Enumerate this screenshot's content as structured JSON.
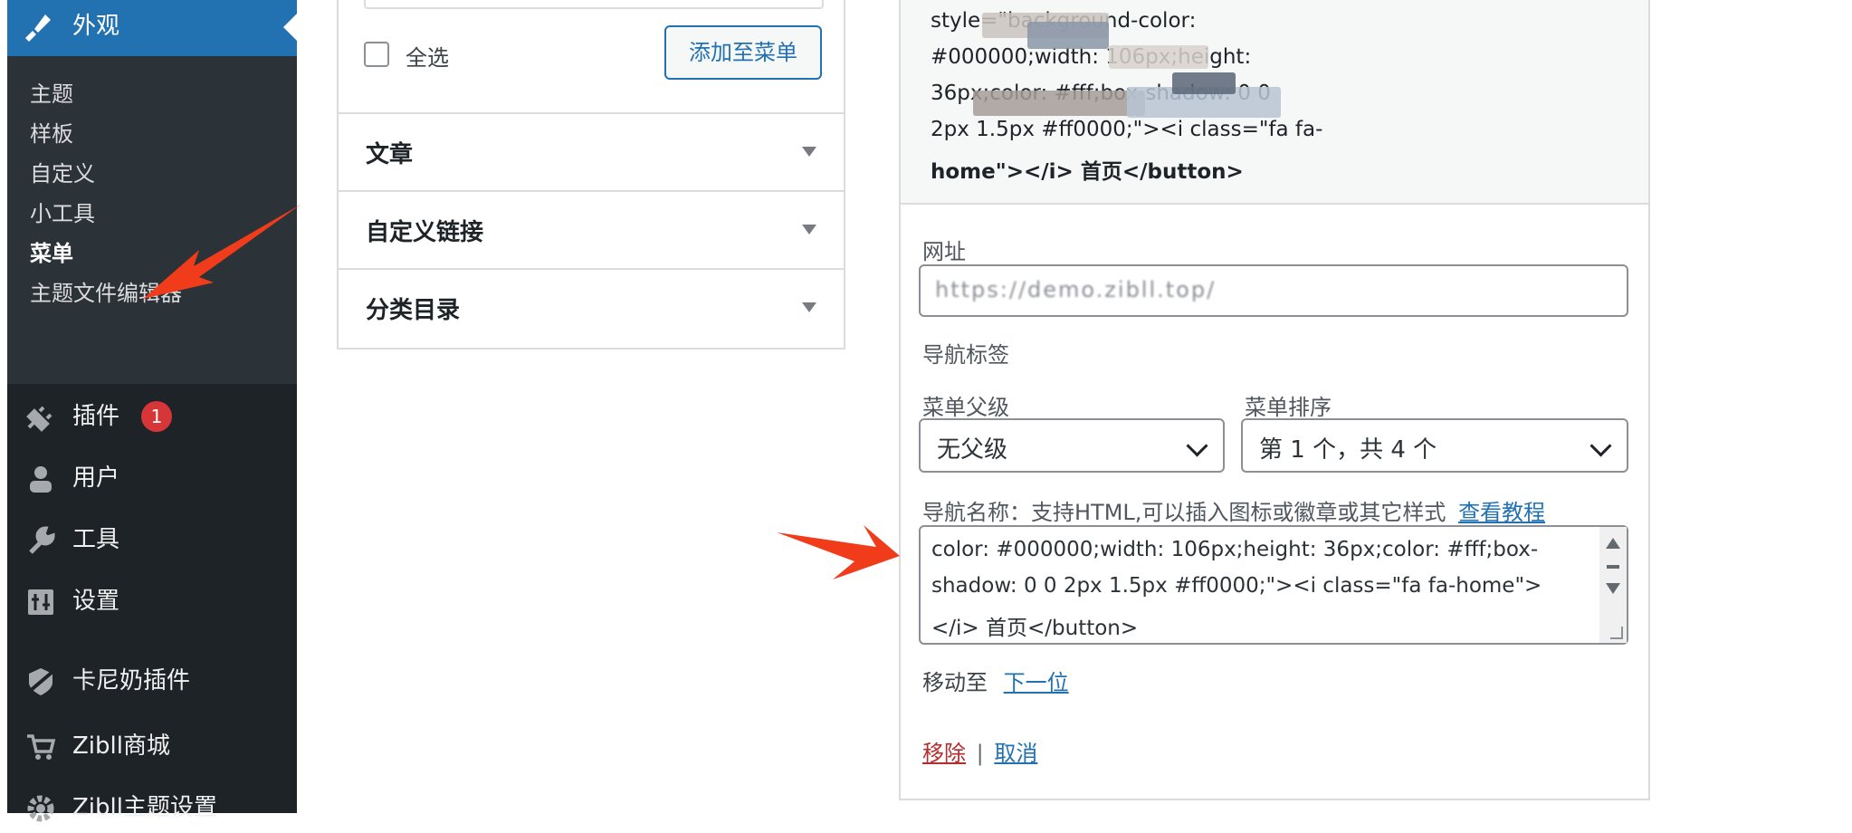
{
  "sidebar": {
    "active_label": "外观",
    "submenu": [
      "主题",
      "样板",
      "自定义",
      "小工具",
      "菜单",
      "主题文件编辑器"
    ],
    "current_submenu_index": 4,
    "items": [
      {
        "label": "插件",
        "icon": "plugin-icon",
        "badge": "1"
      },
      {
        "label": "用户",
        "icon": "user-icon"
      },
      {
        "label": "工具",
        "icon": "wrench-icon"
      },
      {
        "label": "设置",
        "icon": "settings-icon"
      },
      {
        "label": "卡尼奶插件",
        "icon": "shield-slash-icon"
      },
      {
        "label": "Zibll商城",
        "icon": "cart-icon"
      },
      {
        "label": "Zibll主题设置",
        "icon": "gear-icon"
      }
    ]
  },
  "middle": {
    "select_all_label": "全选",
    "add_button": "添加至菜单",
    "accordions": [
      "文章",
      "自定义链接",
      "分类目录"
    ]
  },
  "right": {
    "preview_lines": [
      "style=\"background-color:",
      "#000000;width: 106px;height:",
      "36px;color: #fff;box-shadow: 0 0",
      "2px 1.5px #ff0000;\"><i class=\"fa fa-",
      "home\"></i> 首页</button>"
    ],
    "url_label": "网址",
    "url_value": "https://demo.zibll.top/",
    "nav_tag_label": "导航标签",
    "parent_label": "菜单父级",
    "parent_value": "无父级",
    "order_label": "菜单排序",
    "order_value": "第 1 个，共 4 个",
    "nav_name_label": "导航名称：支持HTML,可以插入图标或徽章或其它样式",
    "nav_name_link": "查看教程",
    "nav_name_lines": [
      "color: #000000;width: 106px;height: 36px;color: #fff;box-",
      "shadow: 0 0 2px 1.5px #ff0000;\"><i class=\"fa fa-home\">",
      "</i> 首页</button>"
    ],
    "move_label": "移动至",
    "move_link": "下一位",
    "remove_link": "移除",
    "separator": "|",
    "cancel_link": "取消"
  },
  "colors": {
    "sidebar_bg": "#1d2327",
    "submenu_bg": "#2c3338",
    "accent": "#2271b1",
    "badge": "#d63638",
    "arrow": "#f03c1a",
    "remove": "#b32d2e"
  }
}
